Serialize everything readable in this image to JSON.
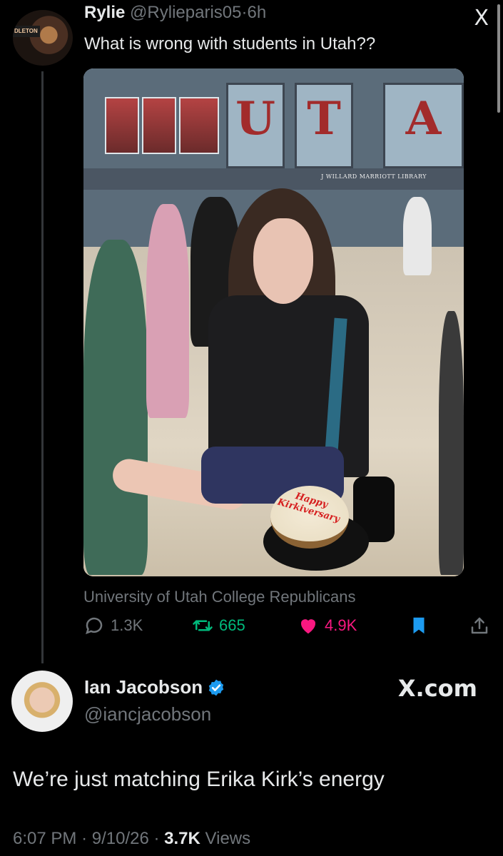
{
  "quoted_tweet": {
    "display_name": "Rylie",
    "handle": "@Rylieparis05",
    "separator": "·",
    "time_ago": "6h",
    "text": "What is wrong with students in Utah??",
    "close_label": "X",
    "avatar_badge": "DLETON",
    "photo": {
      "banner_letters": [
        "U",
        "T",
        "A"
      ],
      "building_sign": "J WILLARD MARRIOTT LIBRARY",
      "cake_text": "Happy Kirkiversary"
    },
    "source_label": "University of Utah College Republicans",
    "stats": {
      "replies": "1.3K",
      "retweets": "665",
      "likes": "4.9K"
    }
  },
  "main_tweet": {
    "display_name": "Ian Jacobson",
    "handle": "@iancjacobson",
    "brand": "X.com",
    "text": "We’re just matching Erika Kirk’s energy",
    "time": "6:07 PM",
    "date": "9/10/26",
    "separator": "·",
    "views_count": "3.7K",
    "views_label": "Views"
  },
  "colors": {
    "background": "#000000",
    "primary_text": "#e7e9ea",
    "secondary_text": "#71767b",
    "retweet": "#00ba7c",
    "like": "#f91880",
    "accent_blue": "#1d9bf0"
  },
  "icons": {
    "reply": "reply-icon",
    "retweet": "retweet-icon",
    "like": "heart-icon",
    "bookmark": "bookmark-icon",
    "share": "share-icon",
    "verified": "verified-badge-icon"
  }
}
